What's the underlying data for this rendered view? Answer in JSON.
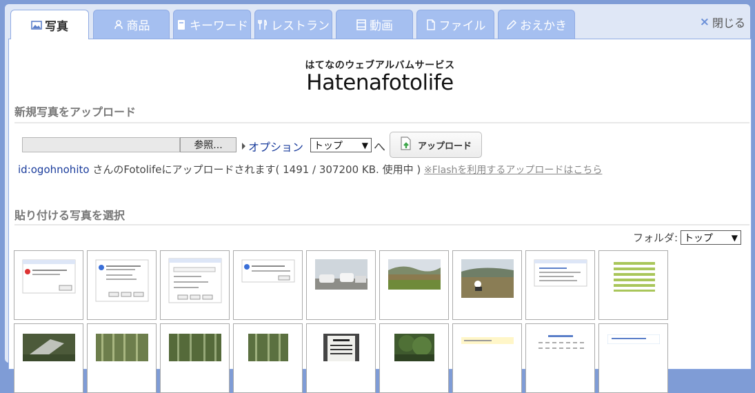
{
  "tabs": [
    {
      "label": "写真",
      "icon": "photo-icon",
      "active": true
    },
    {
      "label": "商品",
      "icon": "product-icon",
      "active": false
    },
    {
      "label": "キーワード",
      "icon": "keyword-icon",
      "active": false
    },
    {
      "label": "レストラン",
      "icon": "restaurant-icon",
      "active": false
    },
    {
      "label": "動画",
      "icon": "video-icon",
      "active": false
    },
    {
      "label": "ファイル",
      "icon": "file-icon",
      "active": false
    },
    {
      "label": "おえかき",
      "icon": "pencil-icon",
      "active": false
    }
  ],
  "close_label": "閉じる",
  "brand": {
    "subtitle": "はてなのウェブアルバムサービス",
    "logo": "Hatenafotolife"
  },
  "upload": {
    "section_title": "新規写真をアップロード",
    "browse_label": "参照...",
    "option_label": "オプション",
    "folder_select": "トップ",
    "to_label": "へ",
    "upload_label": "アップロード",
    "user_id": "id:ogohnohito",
    "status_text": " さんのFotolifeにアップロードされます( 1491 / 307200 KB. 使用中 ) ",
    "flash_link": "※Flashを利用するアップロードはこちら"
  },
  "select": {
    "section_title": "貼り付ける写真を選択",
    "folder_label": "フォルダ:",
    "folder_value": "トップ"
  },
  "thumbnails": [
    {
      "kind": "dialog-error"
    },
    {
      "kind": "dialog-info"
    },
    {
      "kind": "dialog-form"
    },
    {
      "kind": "dialog-small"
    },
    {
      "kind": "photo-cars"
    },
    {
      "kind": "photo-field"
    },
    {
      "kind": "photo-field2"
    },
    {
      "kind": "screenshot-list"
    },
    {
      "kind": "screenshot-bars"
    },
    {
      "kind": "photo-bamboo"
    },
    {
      "kind": "photo-bamboo2"
    },
    {
      "kind": "photo-bamboo3"
    },
    {
      "kind": "photo-bamboo4"
    },
    {
      "kind": "photo-sign"
    },
    {
      "kind": "photo-forest"
    },
    {
      "kind": "screenshot-yellow"
    },
    {
      "kind": "screenshot-calendar"
    },
    {
      "kind": "screenshot-text"
    }
  ],
  "colors": {
    "accent": "#a5bff0",
    "link": "#1a3c9c",
    "background": "#7f9cd6"
  }
}
